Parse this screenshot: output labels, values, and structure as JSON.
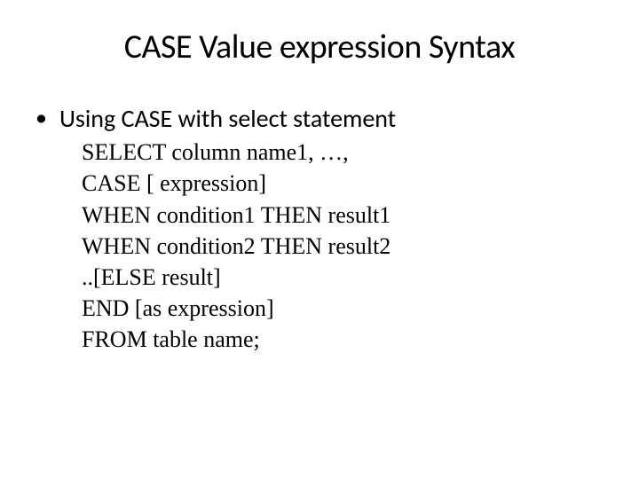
{
  "title": "CASE Value expression Syntax",
  "bullet": "•",
  "bulletText": "Using CASE  with select statement",
  "code": {
    "line1": "SELECT column name1, …, ",
    "line2": "CASE [ expression] ",
    "line3": "WHEN condition1 THEN result1",
    "line4": "WHEN condition2 THEN result2",
    "line5": "..[ELSE result] ",
    "line6": "END  [as expression]",
    "line7": "FROM table name;"
  }
}
